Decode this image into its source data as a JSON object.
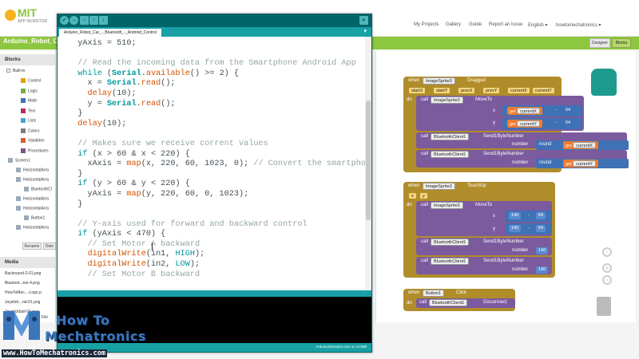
{
  "appinventor": {
    "logo_text": "MIT",
    "logo_subtext": "APP INVENTOR",
    "nav": [
      "My Projects",
      "Gallery",
      "Guide",
      "Report an Issue",
      "English ▾",
      "howtomechatronics ▾"
    ],
    "project_title": "Arduino_Robot_C",
    "designer_label": "Designer",
    "blocks_label": "Blocks",
    "blocks_panel_title": "Blocks",
    "builtin_label": "Built-in",
    "builtin_items": [
      {
        "label": "Control",
        "color": "#e1a400"
      },
      {
        "label": "Logic",
        "color": "#77ab41"
      },
      {
        "label": "Math",
        "color": "#3f71b5"
      },
      {
        "label": "Text",
        "color": "#b32d5e"
      },
      {
        "label": "Lists",
        "color": "#49a6d4"
      },
      {
        "label": "Colors",
        "color": "#7d7d7d"
      },
      {
        "label": "Variables",
        "color": "#d05f2d"
      },
      {
        "label": "Procedures",
        "color": "#7c5385"
      }
    ],
    "screen_items": [
      "Screen1",
      "HorizontalArra",
      "HorizontalArra",
      "BluetoothCl",
      "HorizontalArra",
      "HorizontalArra",
      "Button1",
      "HorizontalArra"
    ],
    "rename_label": "Rename",
    "delete_label": "Dele",
    "media_title": "Media",
    "media_items": [
      "Backround-2-01.png",
      "Bluetoot...ton-4.png",
      "HowToMec...-Logo.p",
      "Joystick...nd-01.png",
      "Joystickball-01.png"
    ],
    "file_label": "File",
    "blocks": {
      "ev1_when": "when",
      "ev1_component": "ImageSprite3",
      "ev1_event": "Dragged",
      "ev1_params": [
        "startX",
        "startY",
        "prevX",
        "prevY",
        "currentX",
        "currentY"
      ],
      "do": "do",
      "call": "call",
      "moveto": "MoveTo",
      "x": "x",
      "y": "y",
      "get": "get",
      "currentX": "currentX",
      "currentY": "currentY",
      "minus": "-",
      "n64": "64",
      "bt1": "BluetoothClient1",
      "send": "Send1ByteNumber",
      "number": "number",
      "round": "round",
      "ev2_component": "ImageSprite3",
      "ev2_event": "TouchUp",
      "ev2_params": [
        "x",
        "y"
      ],
      "n140": "140",
      "ev3_component": "Button1",
      "ev3_event": "Click",
      "disconnect": "Disconnect"
    }
  },
  "ide": {
    "tab_title": "Arduino_Robot_Car_-_Bluetooth_-_Android_Control",
    "tab_menu": "▾",
    "status": "Arduino/Genuino Uno on COM8"
  },
  "watermark": {
    "line1": "How To",
    "line2": "Mechatronics",
    "url": "www.HowToMechatronics.com"
  },
  "colors": {
    "ide_teal": "#006468",
    "ide_tab_teal": "#17a1a5",
    "ai_green": "#8dc63f",
    "block_olive": "#b08d2a",
    "block_purple": "#7b5a9e",
    "block_blue": "#3f71b5",
    "block_orange": "#f17b2e"
  }
}
